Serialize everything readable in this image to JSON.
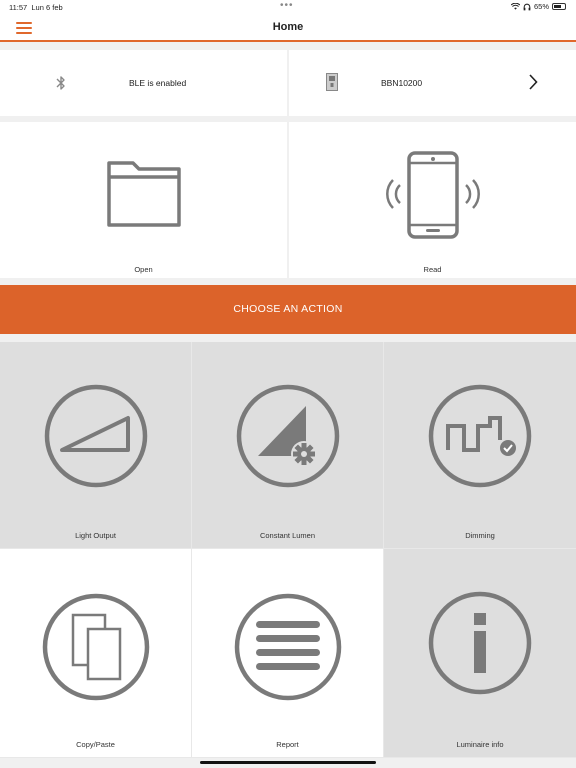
{
  "status": {
    "time": "11:57",
    "date": "Lun 6 feb",
    "battery": "65%",
    "battery_level": 0.65
  },
  "nav": {
    "title": "Home"
  },
  "ble": {
    "label": "BLE is enabled"
  },
  "device": {
    "label": "BBN10200"
  },
  "files": {
    "open_label": "Open",
    "read_label": "Read"
  },
  "action": {
    "label": "CHOOSE AN ACTION"
  },
  "tiles": [
    {
      "label": "Light Output"
    },
    {
      "label": "Constant Lumen"
    },
    {
      "label": "Dimming"
    },
    {
      "label": "Copy/Paste"
    },
    {
      "label": "Report"
    },
    {
      "label": "Luminaire info"
    }
  ],
  "colors": {
    "accent": "#dc632a",
    "icon": "#7a7a7a"
  }
}
